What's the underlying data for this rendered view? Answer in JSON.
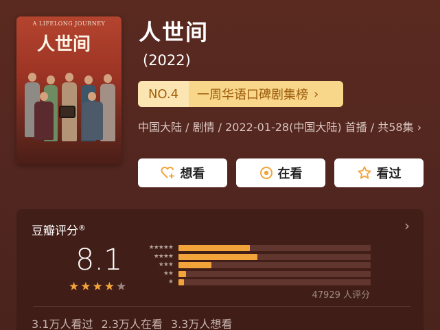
{
  "poster": {
    "title_en": "A LIFELONG JOURNEY",
    "title_cn": "人世间"
  },
  "show": {
    "title": "人世间",
    "year": "(2022)"
  },
  "rank": {
    "number": "NO.4",
    "label": "一周华语口碑剧集榜",
    "chevron": "›"
  },
  "meta": {
    "text": "中国大陆 / 剧情 / 2022-01-28(中国大陆) 首播 / 共58集"
  },
  "actions": {
    "want": {
      "label": "想看",
      "icon": "heart-plus-icon"
    },
    "watching": {
      "label": "在看",
      "icon": "target-circle-icon"
    },
    "watched": {
      "label": "看过",
      "icon": "star-outline-icon"
    }
  },
  "rating": {
    "title": "豆瓣评分",
    "title_mark": "®",
    "score": "8.1",
    "stars_filled": 4,
    "stars_total": 5,
    "distribution": [
      {
        "stars": "★★★★★",
        "percent": 37
      },
      {
        "stars": "★★★★",
        "percent": 41
      },
      {
        "stars": "★★★",
        "percent": 17
      },
      {
        "stars": "★★",
        "percent": 4
      },
      {
        "stars": "★",
        "percent": 3
      }
    ],
    "count": "47929 人评分",
    "chevron": "›"
  },
  "stats": {
    "watched": "3.1万人看过",
    "watching": "2.3万人在看",
    "want": "3.3万人想看"
  },
  "colors": {
    "background": "#522620",
    "accent_orange": "#f2a33a",
    "rank_gold": "#f8d68a"
  }
}
